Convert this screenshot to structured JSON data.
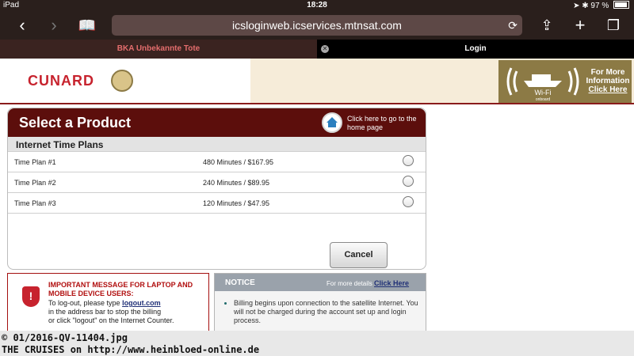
{
  "status": {
    "device": "iPad",
    "time": "18:28",
    "battery": "97 %"
  },
  "browser": {
    "url": "icsloginweb.icservices.mtnsat.com",
    "tabs": [
      {
        "label": "BKA Unbekannte Tote"
      },
      {
        "label": "Login"
      }
    ]
  },
  "header": {
    "brand": "CUNARD",
    "wifi_label": "Wi-Fi",
    "wifi_sub": "onboard",
    "more_info": "For More Information",
    "click_here": "Click Here"
  },
  "product": {
    "title": "Select a Product",
    "home_note": "Click here to go to the home page",
    "plans_header": "Internet Time Plans",
    "plans": [
      {
        "name": "Time Plan #1",
        "desc": "480 Minutes / $167.95"
      },
      {
        "name": "Time Plan #2",
        "desc": "240 Minutes / $89.95"
      },
      {
        "name": "Time Plan #3",
        "desc": "120 Minutes / $47.95"
      }
    ],
    "cancel": "Cancel"
  },
  "important": {
    "title": "IMPORTANT MESSAGE FOR LAPTOP AND MOBILE DEVICE USERS:",
    "line1": "To log-out, please type",
    "logout_link": "logout.com",
    "line2": "in the address bar to stop the billing",
    "line3": "or click \"logout\" on the Internet Counter."
  },
  "notice": {
    "title": "NOTICE",
    "more": "For more details",
    "more_link": "Click Here",
    "bullet": "Billing begins upon connection to the satellite Internet. You will not be charged during the account set up and login process."
  },
  "footer": {
    "line1": "© 01/2016-QV-11404.jpg",
    "line2": "THE CRUISES on http://www.heinbloed-online.de"
  }
}
